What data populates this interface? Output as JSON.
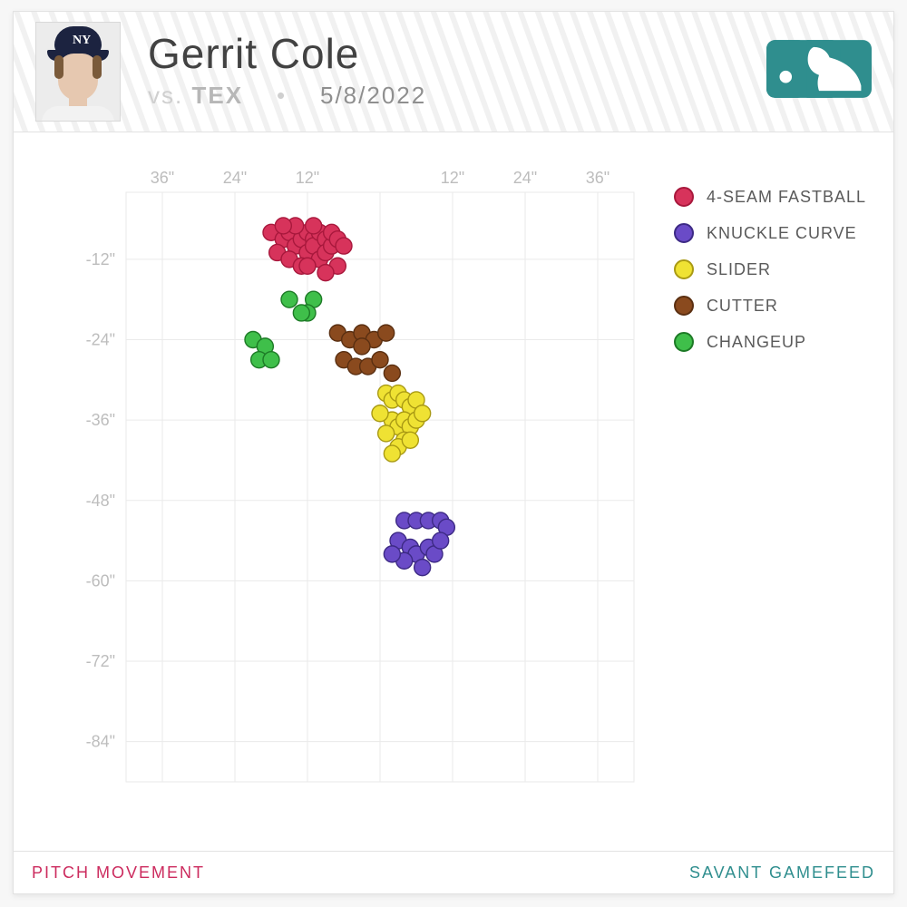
{
  "header": {
    "player_name": "Gerrit Cole",
    "vs_label": "vs.",
    "opponent": "TEX",
    "separator": "•",
    "date": "5/8/2022",
    "cap_initials": "NY"
  },
  "footer": {
    "left": "PITCH MOVEMENT",
    "right": "SAVANT GAMEFEED"
  },
  "legend": [
    {
      "label": "4-SEAM FASTBALL",
      "fill": "#d7335b",
      "stroke": "#a8183c"
    },
    {
      "label": "KNUCKLE CURVE",
      "fill": "#6a4bc7",
      "stroke": "#3d2a85"
    },
    {
      "label": "SLIDER",
      "fill": "#efe233",
      "stroke": "#a99a14"
    },
    {
      "label": "CUTTER",
      "fill": "#8a4a1e",
      "stroke": "#5a2f11"
    },
    {
      "label": "CHANGEUP",
      "fill": "#3fbf4a",
      "stroke": "#1d7a26"
    }
  ],
  "chart_data": {
    "type": "scatter",
    "title": "Pitch Movement",
    "xlabel": "",
    "ylabel": "",
    "x_unit": "inches",
    "y_unit": "inches",
    "x_ticks": [
      -36,
      -24,
      -12,
      0,
      12,
      24,
      36
    ],
    "x_tick_labels": [
      "36\"",
      "24\"",
      "12\"",
      "",
      "12\"",
      "24\"",
      "36\""
    ],
    "y_ticks": [
      -12,
      -24,
      -36,
      -48,
      -60,
      -72,
      -84
    ],
    "y_tick_labels": [
      "-12\"",
      "-24\"",
      "-36\"",
      "-48\"",
      "-60\"",
      "-72\"",
      "-84\""
    ],
    "xlim": [
      -42,
      42
    ],
    "ylim": [
      -90,
      -2
    ],
    "series": [
      {
        "name": "4-SEAM FASTBALL",
        "color": "#d7335b",
        "stroke": "#a8183c",
        "points": [
          {
            "x": -18,
            "y": -8
          },
          {
            "x": -16,
            "y": -9
          },
          {
            "x": -15,
            "y": -8
          },
          {
            "x": -14,
            "y": -10
          },
          {
            "x": -13,
            "y": -9
          },
          {
            "x": -12,
            "y": -8
          },
          {
            "x": -12,
            "y": -11
          },
          {
            "x": -11,
            "y": -9
          },
          {
            "x": -11,
            "y": -10
          },
          {
            "x": -10,
            "y": -8
          },
          {
            "x": -10,
            "y": -12
          },
          {
            "x": -9,
            "y": -9
          },
          {
            "x": -9,
            "y": -11
          },
          {
            "x": -8,
            "y": -10
          },
          {
            "x": -8,
            "y": -8
          },
          {
            "x": -7,
            "y": -9
          },
          {
            "x": -7,
            "y": -13
          },
          {
            "x": -6,
            "y": -10
          },
          {
            "x": -17,
            "y": -11
          },
          {
            "x": -15,
            "y": -12
          },
          {
            "x": -13,
            "y": -13
          },
          {
            "x": -14,
            "y": -7
          },
          {
            "x": -12,
            "y": -13
          },
          {
            "x": -9,
            "y": -14
          },
          {
            "x": -11,
            "y": -7
          },
          {
            "x": -16,
            "y": -7
          }
        ]
      },
      {
        "name": "KNUCKLE CURVE",
        "color": "#6a4bc7",
        "stroke": "#3d2a85",
        "points": [
          {
            "x": 4,
            "y": -51
          },
          {
            "x": 6,
            "y": -51
          },
          {
            "x": 8,
            "y": -51
          },
          {
            "x": 10,
            "y": -51
          },
          {
            "x": 11,
            "y": -52
          },
          {
            "x": 3,
            "y": -54
          },
          {
            "x": 5,
            "y": -55
          },
          {
            "x": 6,
            "y": -56
          },
          {
            "x": 8,
            "y": -55
          },
          {
            "x": 9,
            "y": -56
          },
          {
            "x": 7,
            "y": -58
          },
          {
            "x": 4,
            "y": -57
          },
          {
            "x": 10,
            "y": -54
          },
          {
            "x": 2,
            "y": -56
          }
        ]
      },
      {
        "name": "SLIDER",
        "color": "#efe233",
        "stroke": "#a99a14",
        "points": [
          {
            "x": 1,
            "y": -32
          },
          {
            "x": 2,
            "y": -33
          },
          {
            "x": 3,
            "y": -32
          },
          {
            "x": 4,
            "y": -33
          },
          {
            "x": 5,
            "y": -34
          },
          {
            "x": 6,
            "y": -33
          },
          {
            "x": 2,
            "y": -36
          },
          {
            "x": 3,
            "y": -37
          },
          {
            "x": 4,
            "y": -36
          },
          {
            "x": 5,
            "y": -37
          },
          {
            "x": 6,
            "y": -36
          },
          {
            "x": 7,
            "y": -35
          },
          {
            "x": 1,
            "y": -38
          },
          {
            "x": 4,
            "y": -39
          },
          {
            "x": 3,
            "y": -40
          },
          {
            "x": 2,
            "y": -41
          },
          {
            "x": 5,
            "y": -39
          },
          {
            "x": 0,
            "y": -35
          }
        ]
      },
      {
        "name": "CUTTER",
        "color": "#8a4a1e",
        "stroke": "#5a2f11",
        "points": [
          {
            "x": -7,
            "y": -23
          },
          {
            "x": -5,
            "y": -24
          },
          {
            "x": -3,
            "y": -23
          },
          {
            "x": -1,
            "y": -24
          },
          {
            "x": 1,
            "y": -23
          },
          {
            "x": -6,
            "y": -27
          },
          {
            "x": -4,
            "y": -28
          },
          {
            "x": -2,
            "y": -28
          },
          {
            "x": 0,
            "y": -27
          },
          {
            "x": 2,
            "y": -29
          },
          {
            "x": -3,
            "y": -25
          }
        ]
      },
      {
        "name": "CHANGEUP",
        "color": "#3fbf4a",
        "stroke": "#1d7a26",
        "points": [
          {
            "x": -15,
            "y": -18
          },
          {
            "x": -11,
            "y": -18
          },
          {
            "x": -12,
            "y": -20
          },
          {
            "x": -13,
            "y": -20
          },
          {
            "x": -21,
            "y": -24
          },
          {
            "x": -19,
            "y": -25
          },
          {
            "x": -20,
            "y": -27
          },
          {
            "x": -18,
            "y": -27
          }
        ]
      }
    ]
  }
}
